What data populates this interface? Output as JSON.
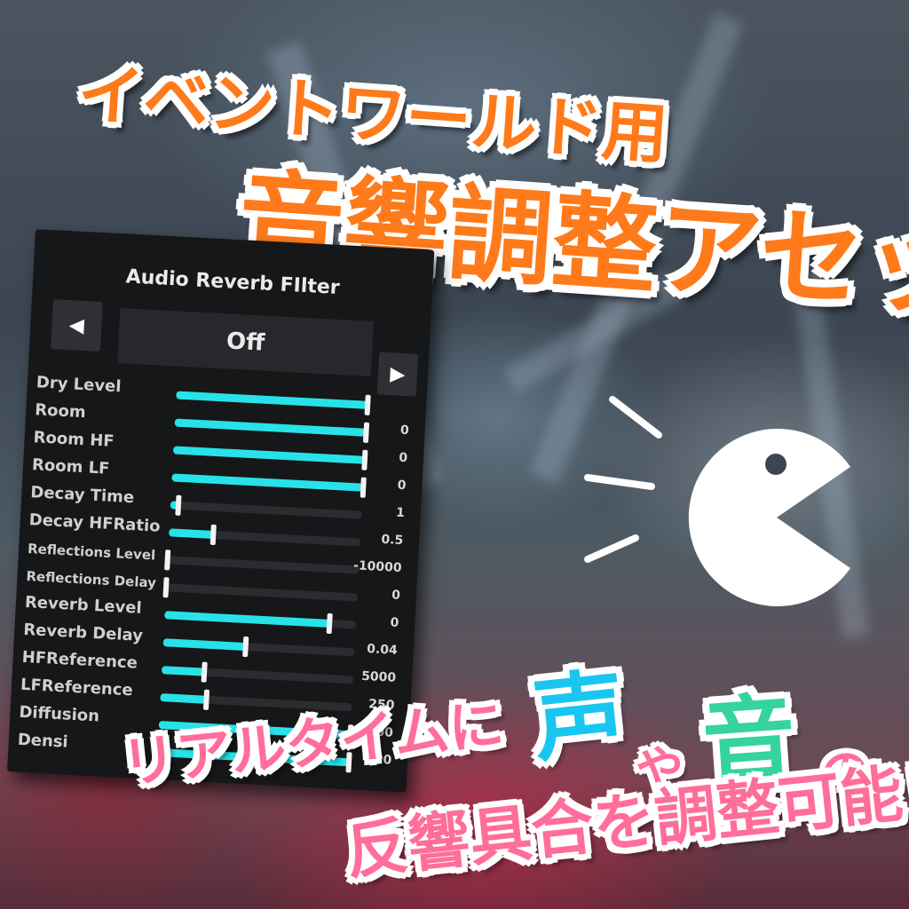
{
  "banner": {
    "title_line1": "イベントワールド用",
    "title_line2": "音響調整アセット",
    "title_color": "#ff7a1a"
  },
  "panel": {
    "title": "Audio Reverb FIlter",
    "prev_icon": "◀",
    "next_icon": "▶",
    "preset_value": "Off",
    "accent_color": "#27e3e8",
    "params": [
      {
        "label": "Dry Level",
        "value": "",
        "level": 1.0
      },
      {
        "label": "Room",
        "value": "0",
        "level": 1.0
      },
      {
        "label": "Room HF",
        "value": "0",
        "level": 1.0
      },
      {
        "label": "Room LF",
        "value": "0",
        "level": 1.0
      },
      {
        "label": "Decay Time",
        "value": "1",
        "level": 0.04
      },
      {
        "label": "Decay HFRatio",
        "value": "0.5",
        "level": 0.23
      },
      {
        "label": "Reflections Level",
        "value": "-10000",
        "level": 0.0
      },
      {
        "label": "Reflections Delay",
        "value": "0",
        "level": 0.0
      },
      {
        "label": "Reverb Level",
        "value": "0",
        "level": 0.86
      },
      {
        "label": "Reverb Delay",
        "value": "0.04",
        "level": 0.43
      },
      {
        "label": "HFReference",
        "value": "5000",
        "level": 0.22
      },
      {
        "label": "LFReference",
        "value": "250",
        "level": 0.24
      },
      {
        "label": "Diffusion",
        "value": "100",
        "level": 1.0
      },
      {
        "label": "Densi",
        "value": "100",
        "level": 1.0
      }
    ]
  },
  "message": {
    "part1": "リアルタイムに",
    "word_voice": "声",
    "part_ya": "や",
    "word_sound": "音",
    "part_no": "の",
    "line2": "反響具合を調整可能！",
    "pink": "#ff6e9a",
    "blue": "#19c6f0",
    "green": "#35d3a0"
  }
}
